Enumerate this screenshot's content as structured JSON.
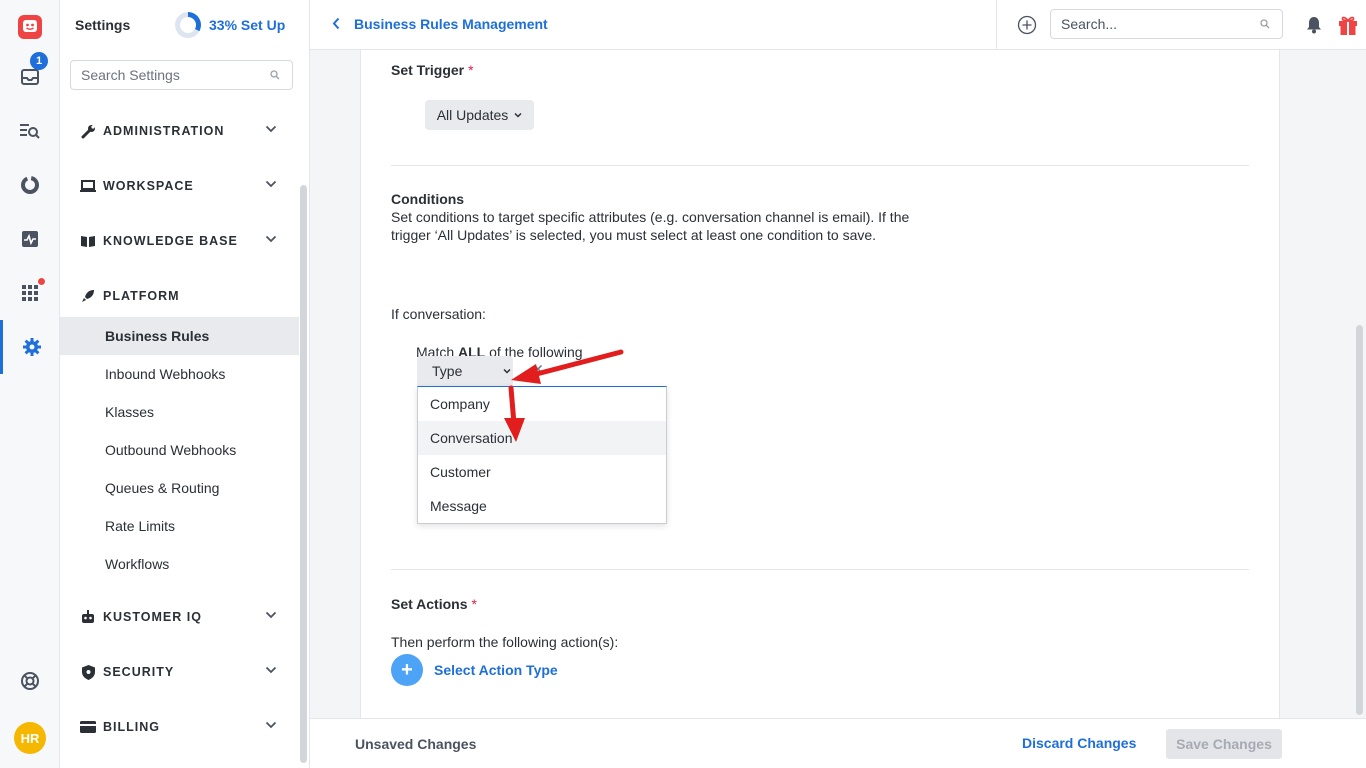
{
  "rail": {
    "inbox_badge": "1",
    "avatar_initials": "HR"
  },
  "settings": {
    "title": "Settings",
    "setup_progress": 0.33,
    "setup_label": "33% Set Up",
    "search_placeholder": "Search Settings",
    "sections": [
      {
        "label": "ADMINISTRATION",
        "icon": "wrench-icon"
      },
      {
        "label": "WORKSPACE",
        "icon": "laptop-icon"
      },
      {
        "label": "KNOWLEDGE BASE",
        "icon": "book-icon"
      },
      {
        "label": "PLATFORM",
        "icon": "rocket-icon"
      },
      {
        "label": "KUSTOMER IQ",
        "icon": "robot-icon"
      },
      {
        "label": "SECURITY",
        "icon": "shield-icon"
      },
      {
        "label": "BILLING",
        "icon": "card-icon"
      }
    ],
    "platform_items": [
      "Business Rules",
      "Inbound Webhooks",
      "Klasses",
      "Outbound Webhooks",
      "Queues & Routing",
      "Rate Limits",
      "Workflows"
    ]
  },
  "topbar": {
    "page_title": "Business Rules Management",
    "search_placeholder": "Search..."
  },
  "main": {
    "set_trigger_label": "Set Trigger",
    "required_mark": "*",
    "trigger_value": "All Updates",
    "conditions_title": "Conditions",
    "conditions_desc": "Set conditions to target specific attributes (e.g. conversation channel is email). If the trigger ‘All Updates’ is selected, you must select at least one condition to save.",
    "if_label": "If conversation:",
    "match_prefix": "Match",
    "match_bold": "ALL",
    "match_suffix": "of the following",
    "type_label": "Type",
    "type_options": [
      "Company",
      "Conversation",
      "Customer",
      "Message"
    ],
    "set_actions_label": "Set Actions",
    "then_label": "Then perform the following action(s):",
    "select_action_label": "Select Action Type"
  },
  "footer": {
    "unsaved": "Unsaved Changes",
    "discard": "Discard Changes",
    "save": "Save Changes"
  },
  "colors": {
    "accent": "#1e6fd9",
    "annotation_arrow": "#e11d1d"
  }
}
